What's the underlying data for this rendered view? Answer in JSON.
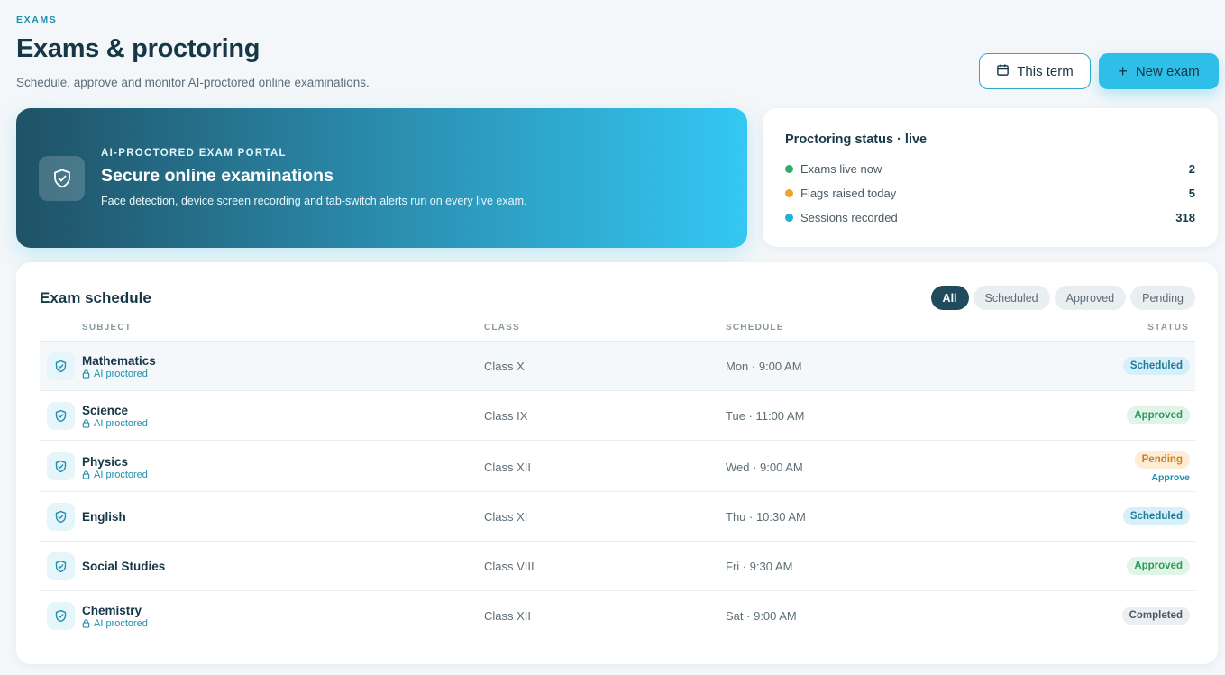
{
  "header": {
    "eyebrow": "EXAMS",
    "title": "Exams & proctoring",
    "subtitle": "Schedule, approve and monitor AI-proctored online examinations.",
    "term_button": "This term",
    "new_button": "New exam"
  },
  "hero": {
    "eyebrow": "AI-PROCTORED EXAM PORTAL",
    "title": "Secure online examinations",
    "description": "Face detection, device screen recording and tab-switch alerts run on every live exam."
  },
  "status": {
    "title": "Proctoring status · live",
    "items": [
      {
        "label": "Exams live now",
        "value": "2",
        "color": "#2fae6a"
      },
      {
        "label": "Flags raised today",
        "value": "5",
        "color": "#f0a42a"
      },
      {
        "label": "Sessions recorded",
        "value": "318",
        "color": "#1fb0dc"
      }
    ]
  },
  "schedule": {
    "title": "Exam schedule",
    "filters": [
      "All",
      "Scheduled",
      "Approved",
      "Pending"
    ],
    "columns": {
      "subject": "SUBJECT",
      "class": "CLASS",
      "schedule": "SCHEDULE",
      "status": "STATUS"
    },
    "proctored_label": "AI proctored",
    "approve_label": "Approve",
    "rows": [
      {
        "subject": "Mathematics",
        "proctored": true,
        "class": "Class X",
        "schedule": "Mon · 9:00 AM",
        "status": "Scheduled"
      },
      {
        "subject": "Science",
        "proctored": true,
        "class": "Class IX",
        "schedule": "Tue · 11:00 AM",
        "status": "Approved"
      },
      {
        "subject": "Physics",
        "proctored": true,
        "class": "Class XII",
        "schedule": "Wed · 9:00 AM",
        "status": "Pending"
      },
      {
        "subject": "English",
        "proctored": false,
        "class": "Class XI",
        "schedule": "Thu · 10:30 AM",
        "status": "Scheduled"
      },
      {
        "subject": "Social Studies",
        "proctored": false,
        "class": "Class VIII",
        "schedule": "Fri · 9:30 AM",
        "status": "Approved"
      },
      {
        "subject": "Chemistry",
        "proctored": true,
        "class": "Class XII",
        "schedule": "Sat · 9:00 AM",
        "status": "Completed"
      }
    ]
  }
}
